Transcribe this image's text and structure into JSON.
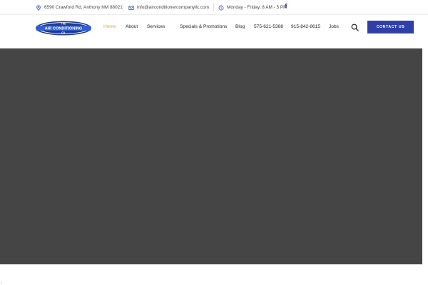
{
  "topbar": {
    "address": "6590 Crawford Rd, Anthony NM 88021",
    "email": "info@airconditionercompanyllc.com",
    "hours": "Monday - Friday, 8 AM - 5 PM",
    "social_icon": "f"
  },
  "logo": {
    "line1": "THE",
    "line2": "AIR CONDITIONING",
    "line3": "CO.",
    "colors": {
      "primary": "#1f3a93",
      "ring": "#2f5fd0"
    }
  },
  "nav": {
    "items": [
      "Home",
      "About",
      "Services",
      "Specials & Promotions",
      "Blog",
      "575-621-5388",
      "915-842-8615",
      "Jobs"
    ],
    "active_color": "#e0a53a",
    "contact_label": "CONTACT US",
    "contact_color": "#2f3fa8"
  },
  "hero": {
    "color": "#454545"
  },
  "corner": {
    "text": "3"
  }
}
